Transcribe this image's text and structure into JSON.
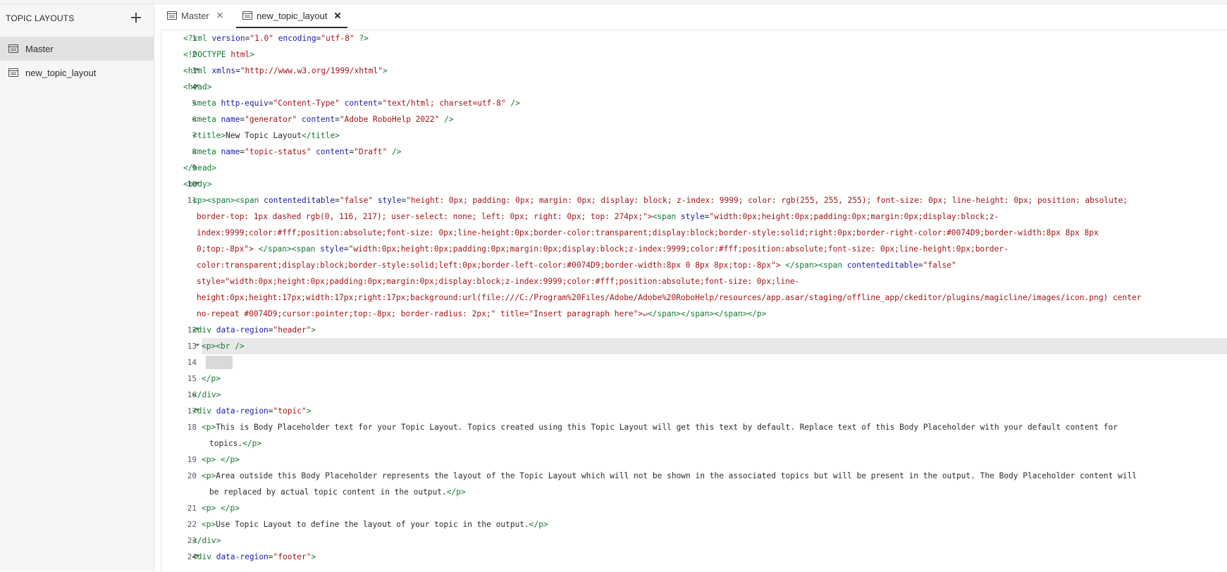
{
  "sidebar": {
    "title": "TOPIC LAYOUTS",
    "add_icon": "plus-icon",
    "items": [
      {
        "label": "Master",
        "icon": "layout-icon",
        "selected": true
      },
      {
        "label": "new_topic_layout",
        "icon": "layout-icon",
        "selected": false
      }
    ]
  },
  "tabs": [
    {
      "label": "Master",
      "icon": "layout-icon",
      "active": false
    },
    {
      "label": "new_topic_layout",
      "icon": "layout-icon",
      "active": true
    }
  ],
  "editor": {
    "highlighted_line": 13,
    "lines": [
      {
        "n": "1",
        "fold": false,
        "indent": 0,
        "text": "<?xml version=\"1.0\" encoding=\"utf-8\" ?>"
      },
      {
        "n": "2",
        "fold": false,
        "indent": 0,
        "text": "<!DOCTYPE html>"
      },
      {
        "n": "3",
        "fold": true,
        "indent": 0,
        "text": "<html xmlns=\"http://www.w3.org/1999/xhtml\">"
      },
      {
        "n": "4",
        "fold": true,
        "indent": 0,
        "text": "<head>"
      },
      {
        "n": "5",
        "fold": false,
        "indent": 1,
        "text": "<meta http-equiv=\"Content-Type\" content=\"text/html; charset=utf-8\" />"
      },
      {
        "n": "6",
        "fold": false,
        "indent": 1,
        "text": "<meta name=\"generator\" content=\"Adobe RoboHelp 2022\" />"
      },
      {
        "n": "7",
        "fold": false,
        "indent": 1,
        "text": "<title>New Topic Layout</title>"
      },
      {
        "n": "8",
        "fold": false,
        "indent": 1,
        "text": "<meta name=\"topic-status\" content=\"Draft\" />"
      },
      {
        "n": "9",
        "fold": false,
        "indent": 0,
        "text": "</head>"
      },
      {
        "n": "10",
        "fold": true,
        "indent": 0,
        "text": "<body>"
      },
      {
        "n": "11",
        "fold": false,
        "indent": 1,
        "text": "<p><span><span contenteditable=\"false\" style=\"height: 0px; padding: 0px; margin: 0px; display: block; z-index: 9999; color: rgb(255, 255, 255); font-size: 0px; line-height: 0px; position: absolute;",
        "wrap": [
          "border-top: 1px dashed rgb(0, 116, 217); user-select: none; left: 0px; right: 0px; top: 274px;\"><span style=\"width:0px;height:0px;padding:0px;margin:0px;display:block;z-",
          "index:9999;color:#fff;position:absolute;font-size: 0px;line-height:0px;border-color:transparent;display:block;border-style:solid;right:0px;border-right-color:#0074D9;border-width:8px 8px 8px",
          "0;top:-8px\"> </span><span style=\"width:0px;height:0px;padding:0px;margin:0px;display:block;z-index:9999;color:#fff;position:absolute;font-size: 0px;line-height:0px;border-",
          "color:transparent;display:block;border-style:solid;left:0px;border-left-color:#0074D9;border-width:8px 0 8px 8px;top:-8px\"> </span><span contenteditable=\"false\"",
          "style=\"width:0px;height:0px;padding:0px;margin:0px;display:block;z-index:9999;color:#fff;position:absolute;font-size: 0px;line-",
          "height:0px;height:17px;width:17px;right:17px;background:url(file:///C:/Program%20Files/Adobe/Adobe%20RoboHelp/resources/app.asar/staging/offline_app/ckeditor/plugins/magicline/images/icon.png) center",
          "no-repeat #0074D9;cursor:pointer;top:-8px; border-radius: 2px;\" title=\"Insert paragraph here\">↵</span></span></span></p>"
        ]
      },
      {
        "n": "12",
        "fold": true,
        "indent": 1,
        "text": "<div data-region=\"header\">"
      },
      {
        "n": "13",
        "fold": true,
        "indent": 2,
        "text": "<p><br />"
      },
      {
        "n": "14",
        "fold": false,
        "indent": 0,
        "text": ""
      },
      {
        "n": "15",
        "fold": false,
        "indent": 2,
        "text": "</p>"
      },
      {
        "n": "16",
        "fold": false,
        "indent": 1,
        "text": "</div>"
      },
      {
        "n": "17",
        "fold": true,
        "indent": 1,
        "text": "<div data-region=\"topic\">"
      },
      {
        "n": "18",
        "fold": false,
        "indent": 2,
        "text": "<p>This is Body Placeholder text for your Topic Layout. Topics created using this Topic Layout will get this text by default. Replace text of this Body Placeholder with your default content for",
        "wrap2": [
          "topics.</p>"
        ]
      },
      {
        "n": "19",
        "fold": false,
        "indent": 2,
        "text": "<p> </p>"
      },
      {
        "n": "20",
        "fold": false,
        "indent": 2,
        "text": "<p>Area outside this Body Placeholder represents the layout of the Topic Layout which will not be shown in the associated topics but will be present in the output. The Body Placeholder content will",
        "wrap2": [
          "be replaced by actual topic content in the output.</p>"
        ]
      },
      {
        "n": "21",
        "fold": false,
        "indent": 2,
        "text": "<p> </p>"
      },
      {
        "n": "22",
        "fold": false,
        "indent": 2,
        "text": "<p>Use Topic Layout to define the layout of your topic in the output.</p>"
      },
      {
        "n": "23",
        "fold": false,
        "indent": 1,
        "text": "</div>"
      },
      {
        "n": "24",
        "fold": true,
        "indent": 1,
        "text": "<div data-region=\"footer\">"
      }
    ]
  }
}
